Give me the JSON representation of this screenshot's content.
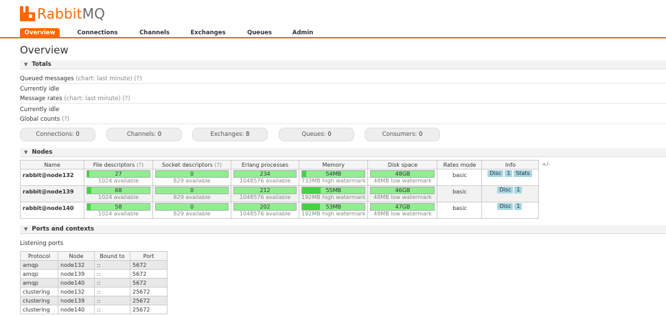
{
  "brand": {
    "name_part1": "Rabbit",
    "name_part2": "MQ",
    "accent": "#ff6600"
  },
  "nav": {
    "tabs": [
      {
        "label": "Overview",
        "active": true
      },
      {
        "label": "Connections"
      },
      {
        "label": "Channels"
      },
      {
        "label": "Exchanges"
      },
      {
        "label": "Queues"
      },
      {
        "label": "Admin"
      }
    ]
  },
  "page_title": "Overview",
  "totals": {
    "heading": "Totals",
    "queued_messages": "Queued messages",
    "queued_messages_hint": "(chart: last minute) (?)",
    "idle1": "Currently idle",
    "message_rates": "Message rates",
    "message_rates_hint": "(chart: last minute) (?)",
    "idle2": "Currently idle",
    "global_counts": "Global counts",
    "global_counts_hint": "(?)",
    "counts": [
      {
        "label": "Connections:",
        "value": "0"
      },
      {
        "label": "Channels:",
        "value": "0"
      },
      {
        "label": "Exchanges:",
        "value": "8"
      },
      {
        "label": "Queues:",
        "value": "0"
      },
      {
        "label": "Consumers:",
        "value": "0"
      }
    ]
  },
  "nodes": {
    "heading": "Nodes",
    "plus_minus": "+/-",
    "columns": {
      "name": "Name",
      "fd": "File descriptors",
      "fd_hint": "(?)",
      "sd": "Socket descriptors",
      "sd_hint": "(?)",
      "erlang": "Erlang processes",
      "memory": "Memory",
      "disk": "Disk space",
      "mode": "Rates mode",
      "info": "Info"
    },
    "rows": [
      {
        "name": "rabbit@node132",
        "fd": "27",
        "fd_sub": "1024 available",
        "fd_fill": 0.03,
        "sd": "0",
        "sd_sub": "829 available",
        "sd_fill": 0.0,
        "erl": "234",
        "erl_sub": "1048576 available",
        "erl_fill": 0.0,
        "mem": "54MB",
        "mem_sub": "733MB high watermark",
        "mem_fill": 0.07,
        "disk": "48GB",
        "disk_sub": "48MB low watermark",
        "disk_fill": 0.0,
        "mode": "basic",
        "badges": [
          "Disc",
          "1",
          "Stats"
        ]
      },
      {
        "name": "rabbit@node139",
        "fd": "68",
        "fd_sub": "1024 available",
        "fd_fill": 0.07,
        "sd": "0",
        "sd_sub": "829 available",
        "sd_fill": 0.0,
        "erl": "212",
        "erl_sub": "1048576 available",
        "erl_fill": 0.0,
        "mem": "55MB",
        "mem_sub": "192MB high watermark",
        "mem_fill": 0.29,
        "disk": "46GB",
        "disk_sub": "48MB low watermark",
        "disk_fill": 0.0,
        "mode": "basic",
        "badges": [
          "Disc",
          "1"
        ]
      },
      {
        "name": "rabbit@node140",
        "fd": "58",
        "fd_sub": "1024 available",
        "fd_fill": 0.06,
        "sd": "0",
        "sd_sub": "829 available",
        "sd_fill": 0.0,
        "erl": "202",
        "erl_sub": "1048576 available",
        "erl_fill": 0.0,
        "mem": "53MB",
        "mem_sub": "192MB high watermark",
        "mem_fill": 0.28,
        "disk": "47GB",
        "disk_sub": "48MB low watermark",
        "disk_fill": 0.0,
        "mode": "basic",
        "badges": [
          "Disc",
          "1"
        ]
      }
    ]
  },
  "ports": {
    "heading": "Ports and contexts",
    "listening": "Listening ports",
    "columns": {
      "protocol": "Protocol",
      "node": "Node",
      "bound": "Bound to",
      "port": "Port"
    },
    "rows": [
      {
        "protocol": "amqp",
        "node": "node132",
        "bound": "::",
        "port": "5672"
      },
      {
        "protocol": "amqp",
        "node": "node139",
        "bound": "::",
        "port": "5672"
      },
      {
        "protocol": "amqp",
        "node": "node140",
        "bound": "::",
        "port": "5672"
      },
      {
        "protocol": "clustering",
        "node": "node132",
        "bound": "::",
        "port": "25672"
      },
      {
        "protocol": "clustering",
        "node": "node139",
        "bound": "::",
        "port": "25672"
      },
      {
        "protocol": "clustering",
        "node": "node140",
        "bound": "::",
        "port": "25672"
      }
    ]
  }
}
